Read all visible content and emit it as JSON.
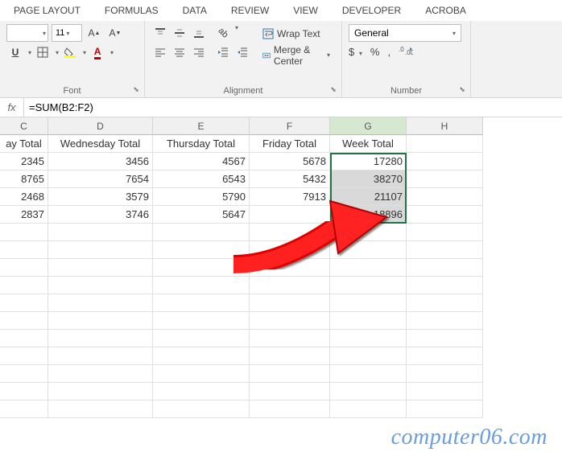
{
  "ribbon": {
    "tabs": [
      "PAGE LAYOUT",
      "FORMULAS",
      "DATA",
      "REVIEW",
      "VIEW",
      "DEVELOPER",
      "ACROBA"
    ],
    "font": {
      "label": "Font",
      "size": "11"
    },
    "alignment": {
      "label": "Alignment",
      "wrap": "Wrap Text",
      "merge": "Merge & Center"
    },
    "number": {
      "label": "Number",
      "format": "General",
      "currency": "$",
      "percent": "%",
      "comma": ","
    }
  },
  "formula_bar": {
    "fx": "fx",
    "value": "=SUM(B2:F2)"
  },
  "columns": [
    "C",
    "D",
    "E",
    "F",
    "G",
    "H"
  ],
  "headers": {
    "C": "ay Total",
    "D": "Wednesday Total",
    "E": "Thursday Total",
    "F": "Friday Total",
    "G": "Week Total",
    "H": ""
  },
  "rows": [
    {
      "C": "2345",
      "D": "3456",
      "E": "4567",
      "F": "5678",
      "G": "17280"
    },
    {
      "C": "8765",
      "D": "7654",
      "E": "6543",
      "F": "5432",
      "G": "38270"
    },
    {
      "C": "2468",
      "D": "3579",
      "E": "5790",
      "F": "7913",
      "G": "21107"
    },
    {
      "C": "2837",
      "D": "3746",
      "E": "5647",
      "F": "",
      "G": "18896"
    }
  ],
  "watermark": "computer06.com"
}
